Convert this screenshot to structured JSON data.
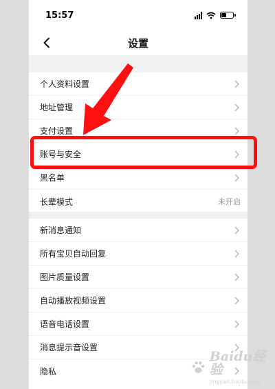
{
  "status_bar": {
    "time": "15:57"
  },
  "nav": {
    "title": "设置"
  },
  "group1": [
    {
      "label": "个人资料设置"
    },
    {
      "label": "地址管理"
    },
    {
      "label": "支付设置"
    },
    {
      "label": "账号与安全"
    },
    {
      "label": "黑名单"
    },
    {
      "label": "长辈模式",
      "value": "未开启"
    }
  ],
  "group2": [
    {
      "label": "新消息通知"
    },
    {
      "label": "所有宝贝自动回复"
    },
    {
      "label": "图片质量设置"
    },
    {
      "label": "自动播放视频设置"
    },
    {
      "label": "语音电话设置"
    },
    {
      "label": "消息提示音设置"
    },
    {
      "label": "隐私"
    }
  ],
  "watermark": {
    "brand": "Baidu经验",
    "url": "jingyan.baidu.com"
  },
  "colors": {
    "annotation_red": "#ff1010",
    "section_gap": "#f0f1f3",
    "chevron": "#b5b5b5"
  }
}
